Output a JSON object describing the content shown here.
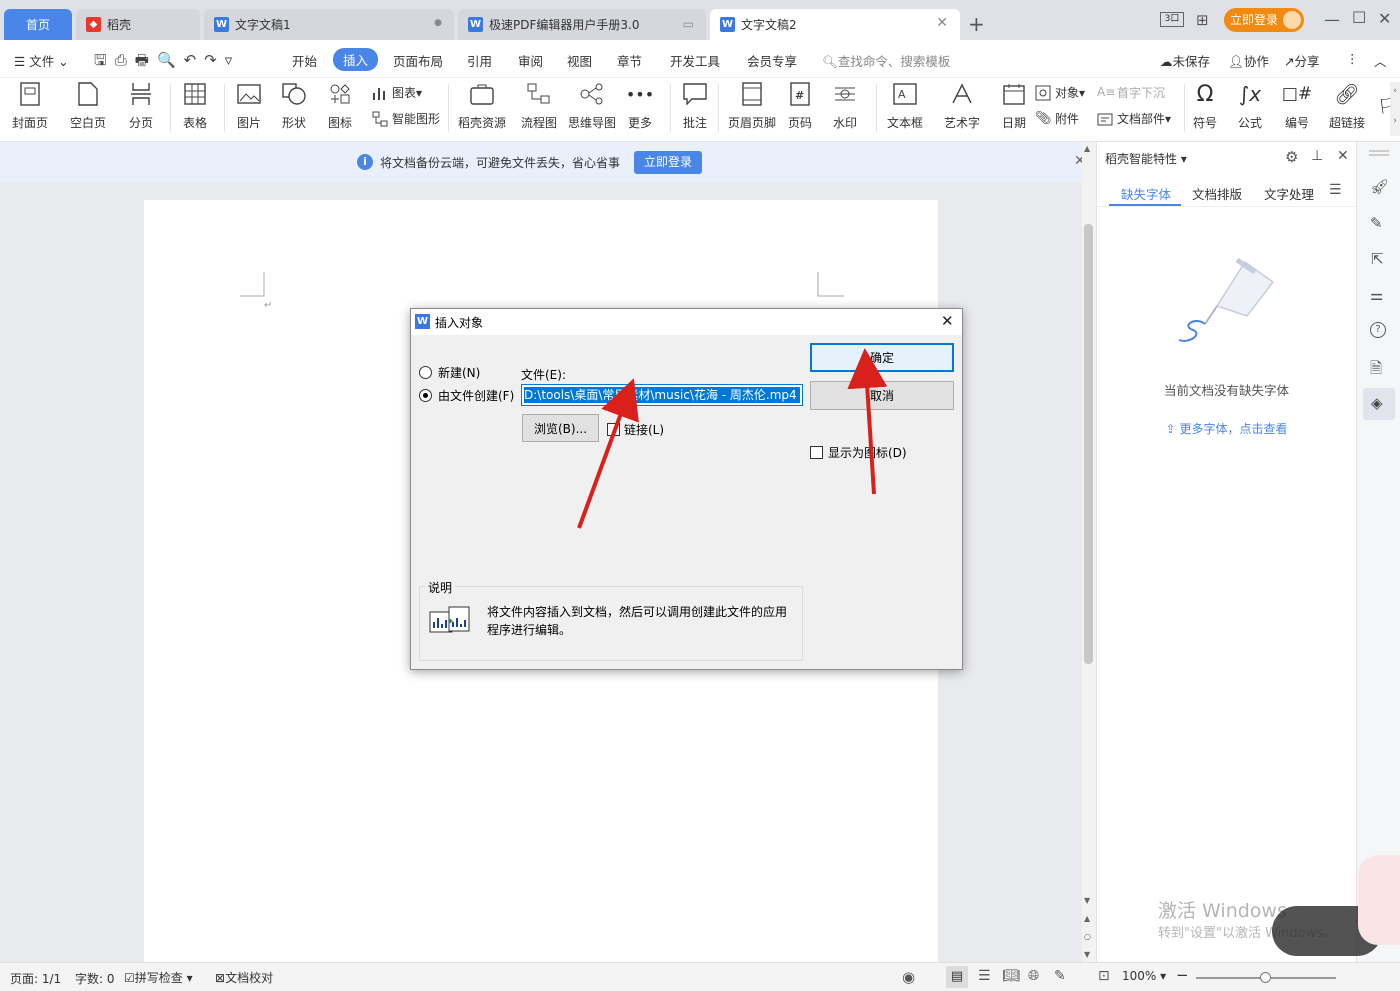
{
  "tabs": {
    "home": "首页",
    "items": [
      {
        "label": "稻壳",
        "icon": "docer-icon"
      },
      {
        "label": "文字文稿1",
        "icon": "writer-icon"
      },
      {
        "label": "极速PDF编辑器用户手册3.0",
        "icon": "writer-icon"
      },
      {
        "label": "文字文稿2",
        "icon": "writer-icon"
      }
    ],
    "login_button": "立即登录"
  },
  "menu": {
    "file": "文件",
    "items": [
      "开始",
      "插入",
      "页面布局",
      "引用",
      "审阅",
      "视图",
      "章节",
      "开发工具",
      "会员专享"
    ],
    "search_placeholder": "查找命令、搜索模板",
    "unsaved": "未保存",
    "collaborate": "协作",
    "share": "分享"
  },
  "ribbon": {
    "cover": "封面页",
    "blank": "空白页",
    "pagebreak": "分页",
    "table": "表格",
    "picture": "图片",
    "shape": "形状",
    "icons": "图标",
    "chart": "图表",
    "smartart": "智能图形",
    "docer_res": "稻壳资源",
    "flowchart": "流程图",
    "mindmap": "思维导图",
    "more": "更多",
    "comment": "批注",
    "header_footer": "页眉页脚",
    "page_number": "页码",
    "watermark": "水印",
    "textbox": "文本框",
    "wordart": "艺术字",
    "date": "日期",
    "object": "对象",
    "attachment": "附件",
    "dropcap": "首字下沉",
    "docparts": "文档部件",
    "symbol": "符号",
    "formula": "公式",
    "numbering": "编号",
    "hyperlink": "超链接"
  },
  "notice": {
    "text": "将文档备份云端，可避免文件丢失，省心省事",
    "button": "立即登录"
  },
  "right_pane": {
    "title": "稻壳智能特性",
    "tabs": [
      "缺失字体",
      "文档排版",
      "文字处理"
    ],
    "empty_text": "当前文档没有缺失字体",
    "more_link": "更多字体，点击查看"
  },
  "dialog": {
    "title": "插入对象",
    "new_label": "新建(N)",
    "from_file_label": "由文件创建(F)",
    "file_label": "文件(E):",
    "file_path": "D:\\tools\\桌面\\常用素材\\music\\花海 - 周杰伦.mp4",
    "browse": "浏览(B)...",
    "link": "链接(L)",
    "ok": "确定",
    "cancel": "取消",
    "display_as_icon": "显示为图标(D)",
    "desc_title": "说明",
    "desc_text": "将文件内容插入到文档，然后可以调用创建此文件的应用程序进行编辑。"
  },
  "status": {
    "page": "页面: 1/1",
    "words": "字数: 0",
    "spellcheck": "拼写检查",
    "proofread": "文档校对",
    "zoom": "100%"
  },
  "watermark": {
    "line1": "激活 Windows",
    "line2": "转到\"设置\"以激活 Windows。"
  },
  "colors": {
    "accent": "#4a86e8",
    "arrow": "#d9201a",
    "login_orange": "#f08a10"
  }
}
